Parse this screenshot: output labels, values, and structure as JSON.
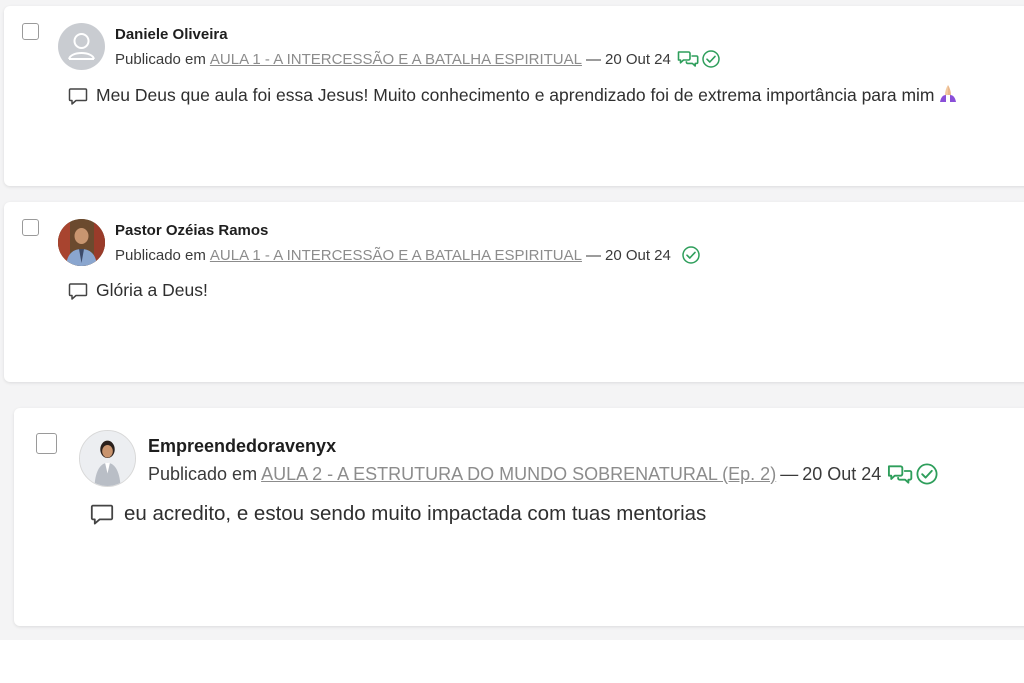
{
  "colors": {
    "accent_green": "#2e9e5b",
    "link_gray": "#8c8c8c",
    "emoji_purple": "#8a4fd8"
  },
  "comments": [
    {
      "author": "Daniele Oliveira",
      "published_prefix": "Publicado em",
      "lesson": "AULA 1 - A INTERCESSÃO E A BATALHA ESPIRITUAL",
      "separator": "—",
      "date": "20 Out 24",
      "icons": [
        "replies-icon",
        "approved-check-icon"
      ],
      "text": "Meu Deus que aula foi essa Jesus! Muito conhecimento e aprendizado foi de extrema importância para mim",
      "emoji": "praying-hands-icon"
    },
    {
      "author": "Pastor Ozéias Ramos",
      "published_prefix": "Publicado em",
      "lesson": "AULA 1 - A INTERCESSÃO E A BATALHA ESPIRITUAL",
      "separator": "—",
      "date": "20 Out 24",
      "icons": [
        "approved-check-icon"
      ],
      "text": "Glória a Deus!"
    },
    {
      "author": "Empreendedoravenyx",
      "published_prefix": "Publicado em",
      "lesson": "AULA 2 - A ESTRUTURA DO MUNDO SOBRENATURAL (Ep. 2)",
      "separator": "—",
      "date": "20 Out 24",
      "icons": [
        "replies-icon",
        "approved-check-icon"
      ],
      "text": "eu acredito, e estou sendo muito impactada com tuas mentorias"
    }
  ]
}
